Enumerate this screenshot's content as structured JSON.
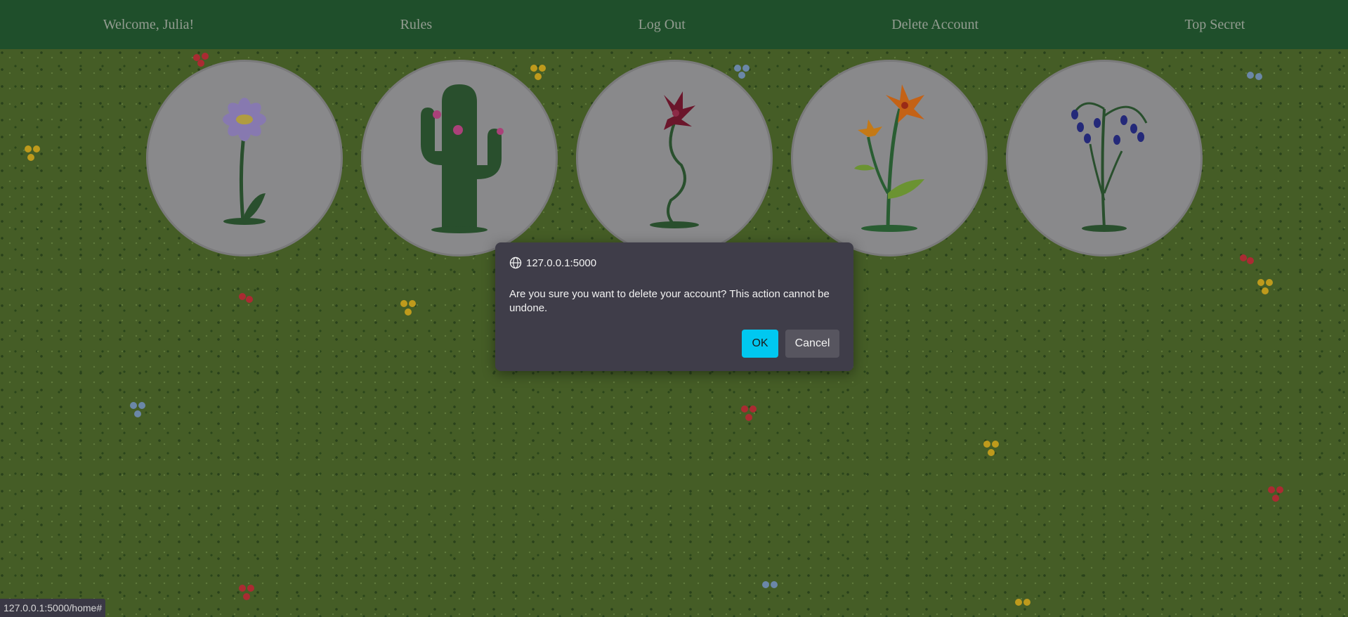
{
  "nav": {
    "welcome": "Welcome, Julia!",
    "rules": "Rules",
    "logout": "Log Out",
    "delete_account": "Delete Account",
    "top_secret": "Top Secret"
  },
  "plants": [
    {
      "name": "daisy-flower",
      "color": "#9a8ac9"
    },
    {
      "name": "cactus",
      "color": "#2f5a34"
    },
    {
      "name": "red-lily",
      "color": "#7a1a32"
    },
    {
      "name": "orange-tiger-lily",
      "color": "#e0701a"
    },
    {
      "name": "bluebell",
      "color": "#2a2f8a"
    }
  ],
  "dialog": {
    "origin": "127.0.0.1:5000",
    "message": "Are you sure you want to delete your account? This action cannot be undone.",
    "ok_label": "OK",
    "cancel_label": "Cancel"
  },
  "status_bar": {
    "url": "127.0.0.1:5000/home#"
  },
  "colors": {
    "navbar": "#245a32",
    "grass": "#4f6a2c",
    "ok_button": "#00c8f0",
    "dialog_bg": "#3f3d49"
  }
}
